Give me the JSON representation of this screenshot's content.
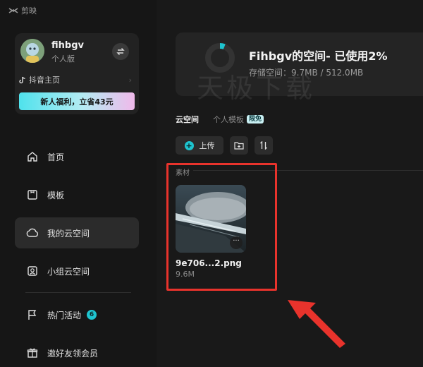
{
  "app": {
    "brand": "剪映"
  },
  "profile": {
    "username": "fihbgv",
    "plan": "个人版",
    "douyin_link": "抖音主页",
    "promo": "新人福利，立省43元"
  },
  "nav": {
    "home": "首页",
    "templates": "模板",
    "my_cloud": "我的云空间",
    "team_cloud": "小组云空间",
    "hot_events": "热门活动",
    "hot_events_badge": "6",
    "invite": "邀好友领会员"
  },
  "storage": {
    "title": "Fihbgv的空间- 已使用2%",
    "usage": "存储空间：9.7MB / 512.0MB",
    "used_fraction": 0.02,
    "watermark": "天极下载"
  },
  "tabs": {
    "cloud": "云空间",
    "personal_templates": "个人模板",
    "free_tag": "限免"
  },
  "toolbar": {
    "upload": "上传"
  },
  "assets": {
    "section_label": "素材",
    "items": [
      {
        "name": "9e706...2.png",
        "size": "9.6M"
      }
    ]
  },
  "colors": {
    "accent": "#1ec4cf",
    "highlight": "#e8332c",
    "background": "#161616"
  },
  "icons": [
    "capcut-logo-icon",
    "swap-icon",
    "tiktok-icon",
    "chevron-right-icon",
    "home-icon",
    "template-icon",
    "cloud-icon",
    "team-cloud-icon",
    "flag-icon",
    "gift-icon",
    "plus-icon",
    "new-folder-icon",
    "sort-icon",
    "more-icon",
    "arrow-pointer-icon"
  ]
}
